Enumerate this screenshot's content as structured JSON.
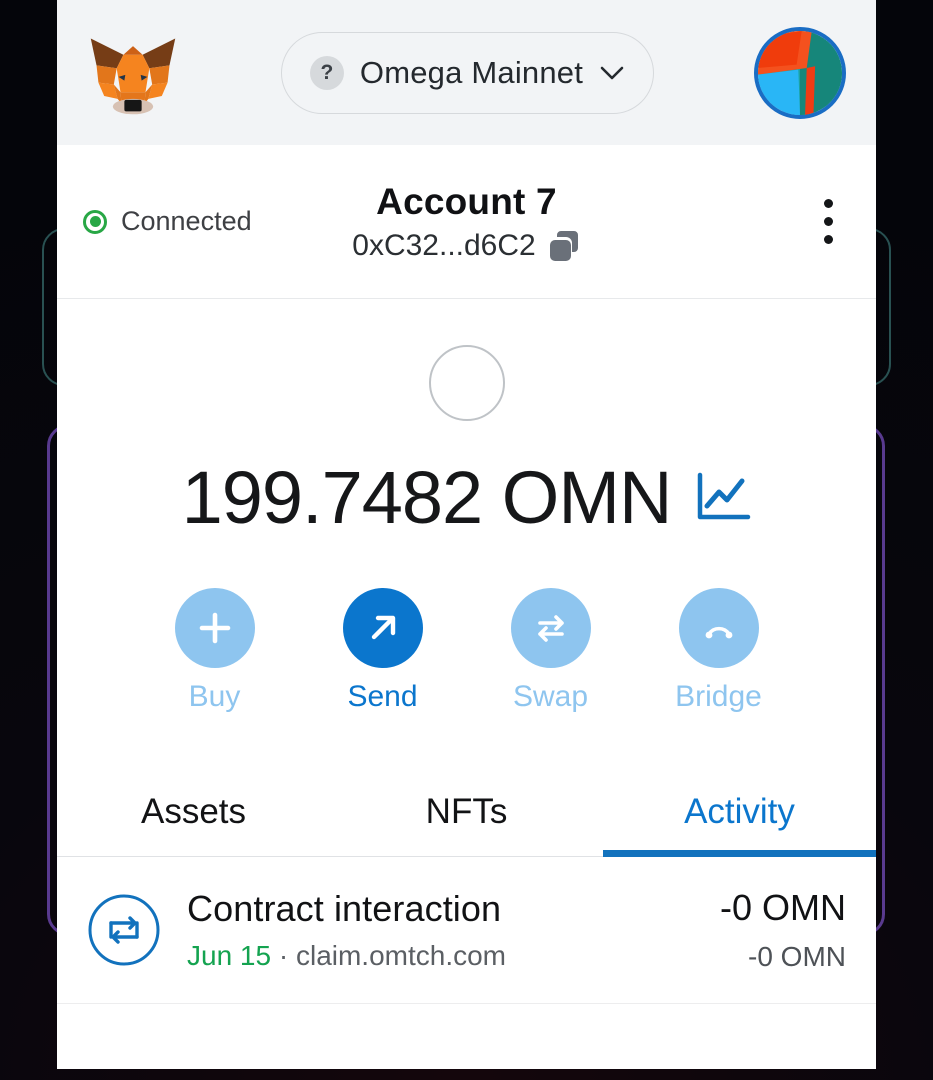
{
  "header": {
    "logo_icon": "metamask-fox-logo",
    "network": {
      "badge_text": "?",
      "name": "Omega Mainnet",
      "chevron_icon": "chevron-down-icon"
    },
    "avatar_icon": "account-identicon-avatar"
  },
  "account": {
    "connected_label": "Connected",
    "name": "Account 7",
    "address": "0xC32...d6C2",
    "copy_icon": "copy-icon",
    "menu_icon": "more-vertical-icon"
  },
  "balance": {
    "token_icon": "token-placeholder-icon",
    "amount": "199.7482 OMN",
    "chart_icon": "portfolio-line-chart-icon"
  },
  "actions": [
    {
      "label": "Buy",
      "icon": "plus-icon",
      "primary": false
    },
    {
      "label": "Send",
      "icon": "arrow-up-right-icon",
      "primary": true
    },
    {
      "label": "Swap",
      "icon": "swap-arrows-icon",
      "primary": false
    },
    {
      "label": "Bridge",
      "icon": "bridge-arc-icon",
      "primary": false
    }
  ],
  "tabs": [
    {
      "label": "Assets",
      "active": false
    },
    {
      "label": "NFTs",
      "active": false
    },
    {
      "label": "Activity",
      "active": true
    }
  ],
  "activity": [
    {
      "icon": "contract-interaction-icon",
      "title": "Contract interaction",
      "date": "Jun 15",
      "separator": " · ",
      "origin": "claim.omtch.com",
      "amount_primary": "-0 OMN",
      "amount_secondary": "-0 OMN"
    }
  ],
  "colors": {
    "accent": "#0b76cd",
    "accent_muted": "#8ec5ef",
    "connected_green": "#28a745",
    "date_green": "#14a350",
    "header_bg": "#f2f4f6",
    "backdrop": "#05060b"
  }
}
